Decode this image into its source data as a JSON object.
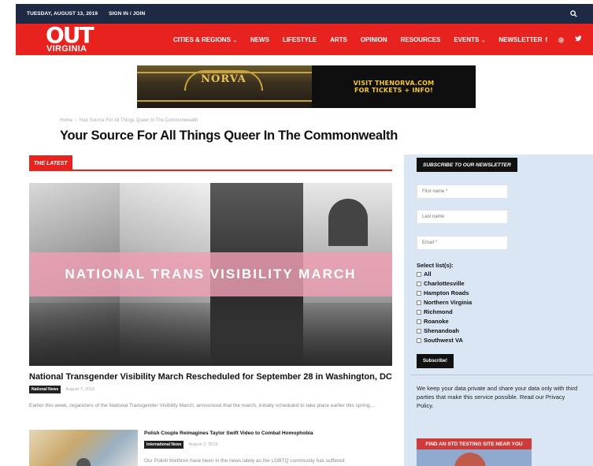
{
  "topbar": {
    "date": "TUESDAY, AUGUST 13, 2019",
    "signin": "SIGN IN / JOIN"
  },
  "logo": {
    "line1": "OUT",
    "line2": "VIRGINIA"
  },
  "nav": {
    "items": [
      {
        "label": "CITIES & REGIONS",
        "caret": "⌄"
      },
      {
        "label": "NEWS",
        "caret": ""
      },
      {
        "label": "LIFESTYLE",
        "caret": ""
      },
      {
        "label": "ARTS",
        "caret": ""
      },
      {
        "label": "OPINION",
        "caret": ""
      },
      {
        "label": "RESOURCES",
        "caret": ""
      },
      {
        "label": "EVENTS",
        "caret": "⌄"
      },
      {
        "label": "NEWSLETTER",
        "caret": ""
      }
    ],
    "social": {
      "facebook": "f",
      "instagram": "◎",
      "twitter": "🐦"
    }
  },
  "banner": {
    "left_name": "NORVA",
    "right_line1": "VISIT THENORVA.COM",
    "right_line2": "FOR TICKETS + INFO!"
  },
  "breadcrumb": {
    "home": "Home",
    "sep": "›",
    "current": "Your Source For All Things Queer In The Commonwealth"
  },
  "page_title": "Your Source For All Things Queer In The Commonwealth",
  "latest": {
    "tab": "THE LATEST"
  },
  "hero": {
    "overlay": "NATIONAL TRANS VISIBILITY MARCH"
  },
  "article1": {
    "title": "National Transgender Visibility March Rescheduled for September 28 in Washington, DC",
    "tag": "National News",
    "date": "August 7, 2019",
    "excerpt": "Earlier this week, organizers of the National Transgender Visibility March, announced that the march, initially scheduled to take place earlier this spring,..."
  },
  "article2": {
    "title": "Polish Couple Reimagines Taylor Swift Video to Combat Homophobia",
    "tag": "International News",
    "date": "August 2, 2019",
    "excerpt": "Our Polish brethren have been in the news lately as the LGBTQ community has suffered"
  },
  "sidebar": {
    "newsletter_heading": "SUBSCRIBE TO OUR NEWSLETTER",
    "first_name_placeholder": "First name *",
    "last_name_placeholder": "Last name",
    "email_placeholder": "Email *",
    "lists_label": "Select list(s):",
    "lists": [
      "All",
      "Charlottesville",
      "Hampton Roads",
      "Northern Virginia",
      "Richmond",
      "Roanoke",
      "Shenandoah",
      "Southwest VA"
    ],
    "subscribe_label": "Subscribe!",
    "privacy_text": "We keep your data private and share your data only with third parties that make this service possible. Read our Privacy Policy.",
    "std_title": "FIND AN STD TESTING SITE NEAR YOU"
  },
  "colors": {
    "brand_red": "#e8221f",
    "topbar_navy": "#1e2a44",
    "sidebar_blue": "#dbe6f5"
  }
}
